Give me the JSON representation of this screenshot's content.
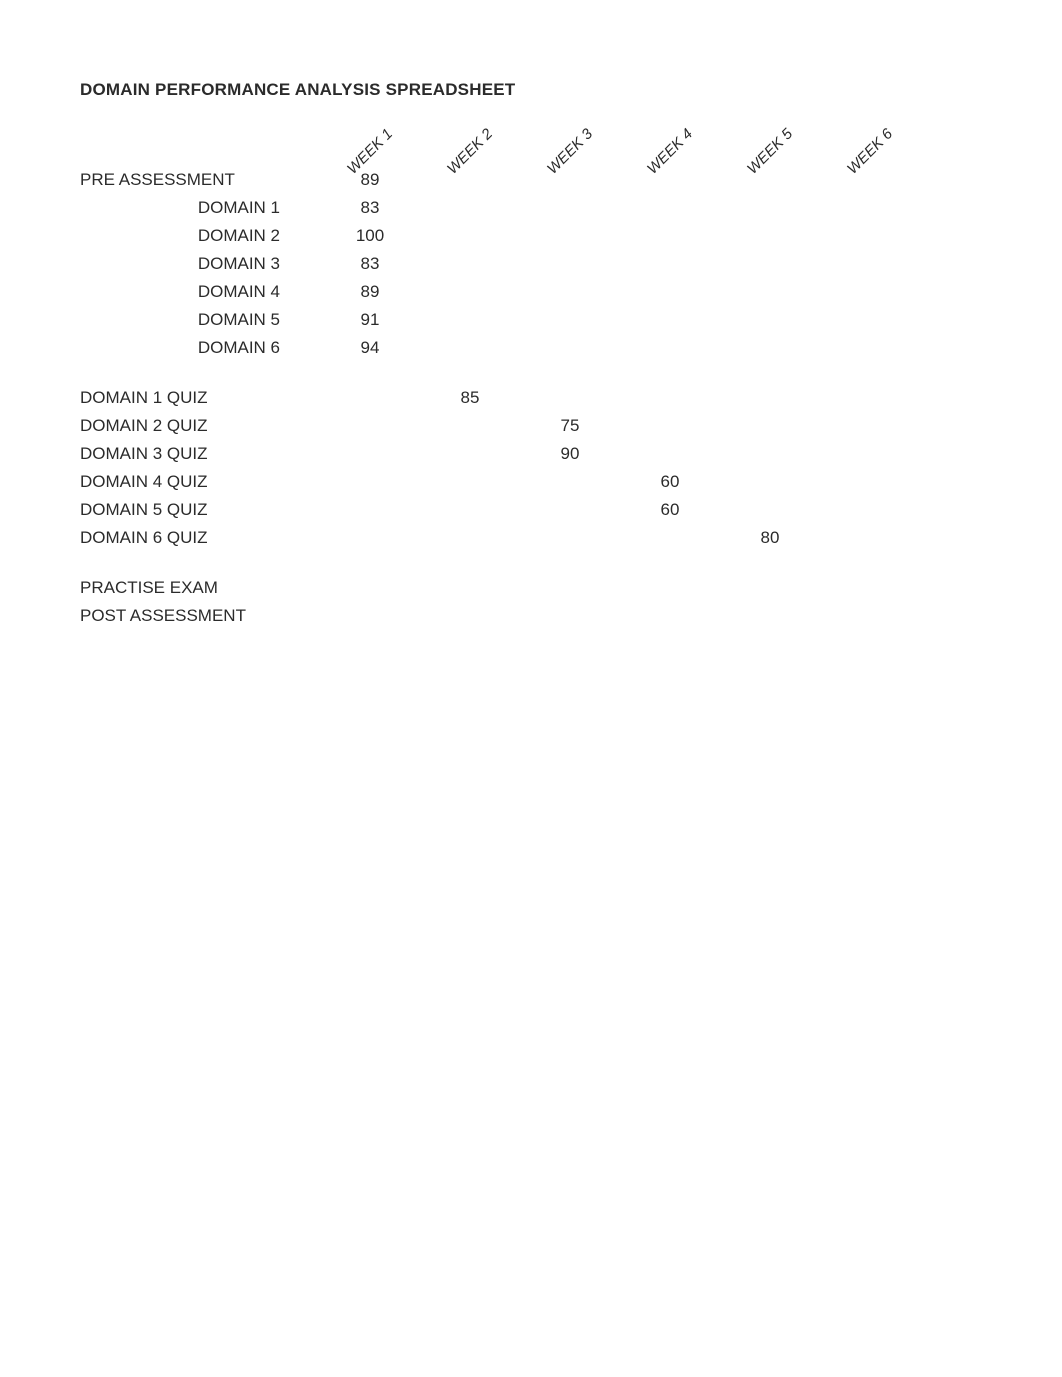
{
  "title": "DOMAIN PERFORMANCE ANALYSIS SPREADSHEET",
  "columns": [
    "WEEK 1",
    "WEEK 2",
    "WEEK 3",
    "WEEK 4",
    "WEEK 5",
    "WEEK 6"
  ],
  "rows": [
    {
      "label": "PRE ASSESSMENT",
      "indent": false,
      "values": [
        "89",
        "",
        "",
        "",
        "",
        ""
      ]
    },
    {
      "label": "DOMAIN 1",
      "indent": true,
      "values": [
        "83",
        "",
        "",
        "",
        "",
        ""
      ]
    },
    {
      "label": "DOMAIN 2",
      "indent": true,
      "values": [
        "100",
        "",
        "",
        "",
        "",
        ""
      ]
    },
    {
      "label": "DOMAIN 3",
      "indent": true,
      "values": [
        "83",
        "",
        "",
        "",
        "",
        ""
      ]
    },
    {
      "label": "DOMAIN 4",
      "indent": true,
      "values": [
        "89",
        "",
        "",
        "",
        "",
        ""
      ]
    },
    {
      "label": "DOMAIN 5",
      "indent": true,
      "values": [
        "91",
        "",
        "",
        "",
        "",
        ""
      ]
    },
    {
      "label": "DOMAIN 6",
      "indent": true,
      "values": [
        "94",
        "",
        "",
        "",
        "",
        ""
      ]
    },
    {
      "spacer": true
    },
    {
      "label": "DOMAIN 1 QUIZ",
      "indent": false,
      "values": [
        "",
        "85",
        "",
        "",
        "",
        ""
      ]
    },
    {
      "label": "DOMAIN 2 QUIZ",
      "indent": false,
      "values": [
        "",
        "",
        "75",
        "",
        "",
        ""
      ]
    },
    {
      "label": "DOMAIN 3 QUIZ",
      "indent": false,
      "values": [
        "",
        "",
        "90",
        "",
        "",
        ""
      ]
    },
    {
      "label": "DOMAIN 4 QUIZ",
      "indent": false,
      "values": [
        "",
        "",
        "",
        "60",
        "",
        ""
      ]
    },
    {
      "label": "DOMAIN 5 QUIZ",
      "indent": false,
      "values": [
        "",
        "",
        "",
        "60",
        "",
        ""
      ]
    },
    {
      "label": "DOMAIN 6 QUIZ",
      "indent": false,
      "values": [
        "",
        "",
        "",
        "",
        "80",
        ""
      ]
    },
    {
      "spacer": true
    },
    {
      "label": "PRACTISE EXAM",
      "indent": false,
      "values": [
        "",
        "",
        "",
        "",
        "",
        ""
      ]
    },
    {
      "label": "POST ASSESSMENT",
      "indent": false,
      "values": [
        "",
        "",
        "",
        "",
        "",
        ""
      ]
    }
  ]
}
